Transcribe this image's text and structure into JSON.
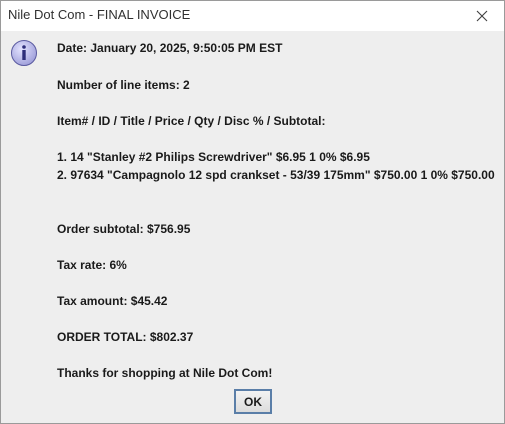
{
  "window": {
    "title": "Nile Dot Com - FINAL INVOICE"
  },
  "icons": {
    "dialog_icon": "info-icon",
    "close_icon": "close-icon"
  },
  "message": {
    "date": "Date: January 20, 2025, 9:50:05 PM EST",
    "line_item_count": "Number of line items: 2",
    "columns_header": "Item# / ID / Title / Price / Qty / Disc % / Subtotal:",
    "items": [
      "1. 14 \"Stanley #2 Philips Screwdriver\" $6.95 1 0% $6.95",
      "2. 97634 \"Campagnolo 12 spd crankset - 53/39 175mm\" $750.00 1 0% $750.00"
    ],
    "order_subtotal": "Order subtotal: $756.95",
    "tax_rate": "Tax rate: 6%",
    "tax_amount": "Tax amount: $45.42",
    "order_total": "ORDER TOTAL: $802.37",
    "thanks": "Thanks for shopping at Nile Dot Com!"
  },
  "buttons": {
    "ok_label": "OK"
  },
  "colors": {
    "dialog_background": "#eeeeee",
    "titlebar_background": "#ffffff",
    "ok_border": "#5a7ea8",
    "info_icon_fill": "#a8a8e0",
    "info_icon_stroke": "#5a5aa0"
  }
}
